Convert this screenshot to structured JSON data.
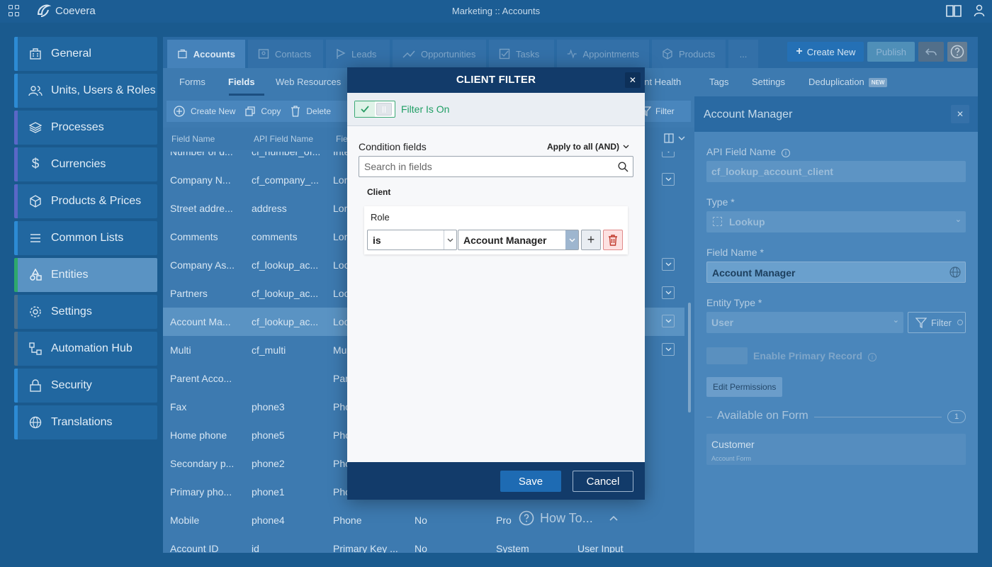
{
  "app": {
    "name": "Coevera",
    "page_title": "Marketing :: Accounts"
  },
  "sidebar": {
    "items": [
      {
        "label": "General"
      },
      {
        "label": "Units, Users & Roles"
      },
      {
        "label": "Processes"
      },
      {
        "label": "Currencies"
      },
      {
        "label": "Products & Prices"
      },
      {
        "label": "Common Lists"
      },
      {
        "label": "Entities"
      },
      {
        "label": "Settings"
      },
      {
        "label": "Automation Hub"
      },
      {
        "label": "Security"
      },
      {
        "label": "Translations"
      }
    ]
  },
  "tabs": [
    {
      "label": "Accounts"
    },
    {
      "label": "Contacts"
    },
    {
      "label": "Leads"
    },
    {
      "label": "Opportunities"
    },
    {
      "label": "Tasks"
    },
    {
      "label": "Appointments"
    },
    {
      "label": "Products"
    },
    {
      "label": "..."
    }
  ],
  "actions": {
    "create_new": "Create New",
    "publish": "Publish"
  },
  "subtabs": {
    "forms": "Forms",
    "fields": "Fields",
    "web_resources": "Web Resources",
    "account_health": "unt Health",
    "tags": "Tags",
    "settings": "Settings",
    "deduplication": "Deduplication",
    "new_badge": "NEW"
  },
  "toolbar": {
    "create_new": "Create New",
    "copy": "Copy",
    "delete": "Delete",
    "filter": "Filter"
  },
  "table": {
    "columns": [
      "Field Name",
      "API Field Name",
      "Fie"
    ],
    "rows": [
      {
        "name": "Number of d...",
        "api": "cf_number_of...",
        "type": "Inte",
        "dd": true
      },
      {
        "name": "Company N...",
        "api": "cf_company_...",
        "type": "Lon",
        "dd": true
      },
      {
        "name": "Street addre...",
        "api": "address",
        "type": "Lon",
        "dd": false
      },
      {
        "name": "Comments",
        "api": "comments",
        "type": "Lon",
        "dd": false
      },
      {
        "name": "Company As...",
        "api": "cf_lookup_ac...",
        "type": "Loo",
        "dd": true
      },
      {
        "name": "Partners",
        "api": "cf_lookup_ac...",
        "type": "Loo",
        "dd": true
      },
      {
        "name": "Account Ma...",
        "api": "cf_lookup_ac...",
        "type": "Loo",
        "dd": true,
        "selected": true
      },
      {
        "name": "Multi",
        "api": "cf_multi",
        "type": "Mu",
        "dd": true
      },
      {
        "name": "Parent Acco...",
        "api": "",
        "type": "Par",
        "dd": false
      },
      {
        "name": "Fax",
        "api": "phone3",
        "type": "Pho",
        "dd": false
      },
      {
        "name": "Home phone",
        "api": "phone5",
        "type": "Pho",
        "dd": false
      },
      {
        "name": "Secondary p...",
        "api": "phone2",
        "type": "Pho",
        "dd": false
      },
      {
        "name": "Primary pho...",
        "api": "phone1",
        "type": "Pho",
        "dd": false
      },
      {
        "name": "Mobile",
        "api": "phone4",
        "type": "Phone",
        "req": "No",
        "src": "Pro",
        "dd": false
      },
      {
        "name": "Account ID",
        "api": "id",
        "type": "Primary Key ...",
        "req": "No",
        "src": "System",
        "input": "User Input",
        "dd": false
      }
    ]
  },
  "right_panel": {
    "title": "Account Manager",
    "api_label": "API Field Name",
    "api_value": "cf_lookup_account_client",
    "type_label": "Type *",
    "type_value": "Lookup",
    "name_label": "Field Name *",
    "name_value": "Account Manager",
    "entity_label": "Entity Type *",
    "entity_value": "User",
    "filter_btn": "Filter",
    "enable_primary": "Enable Primary Record",
    "edit_permissions": "Edit Permissions",
    "available_on_form": "Available on Form",
    "available_count": "1",
    "form_name": "Customer",
    "form_sub": "Account Form"
  },
  "howto": "How To...",
  "modal": {
    "title": "CLIENT FILTER",
    "filter_state": "Filter Is On",
    "condition_fields": "Condition fields",
    "apply_mode": "Apply to all (AND)",
    "search_placeholder": "Search in fields",
    "group": "Client",
    "field": "Role",
    "operator": "is",
    "value": "Account Manager",
    "save": "Save",
    "cancel": "Cancel"
  }
}
